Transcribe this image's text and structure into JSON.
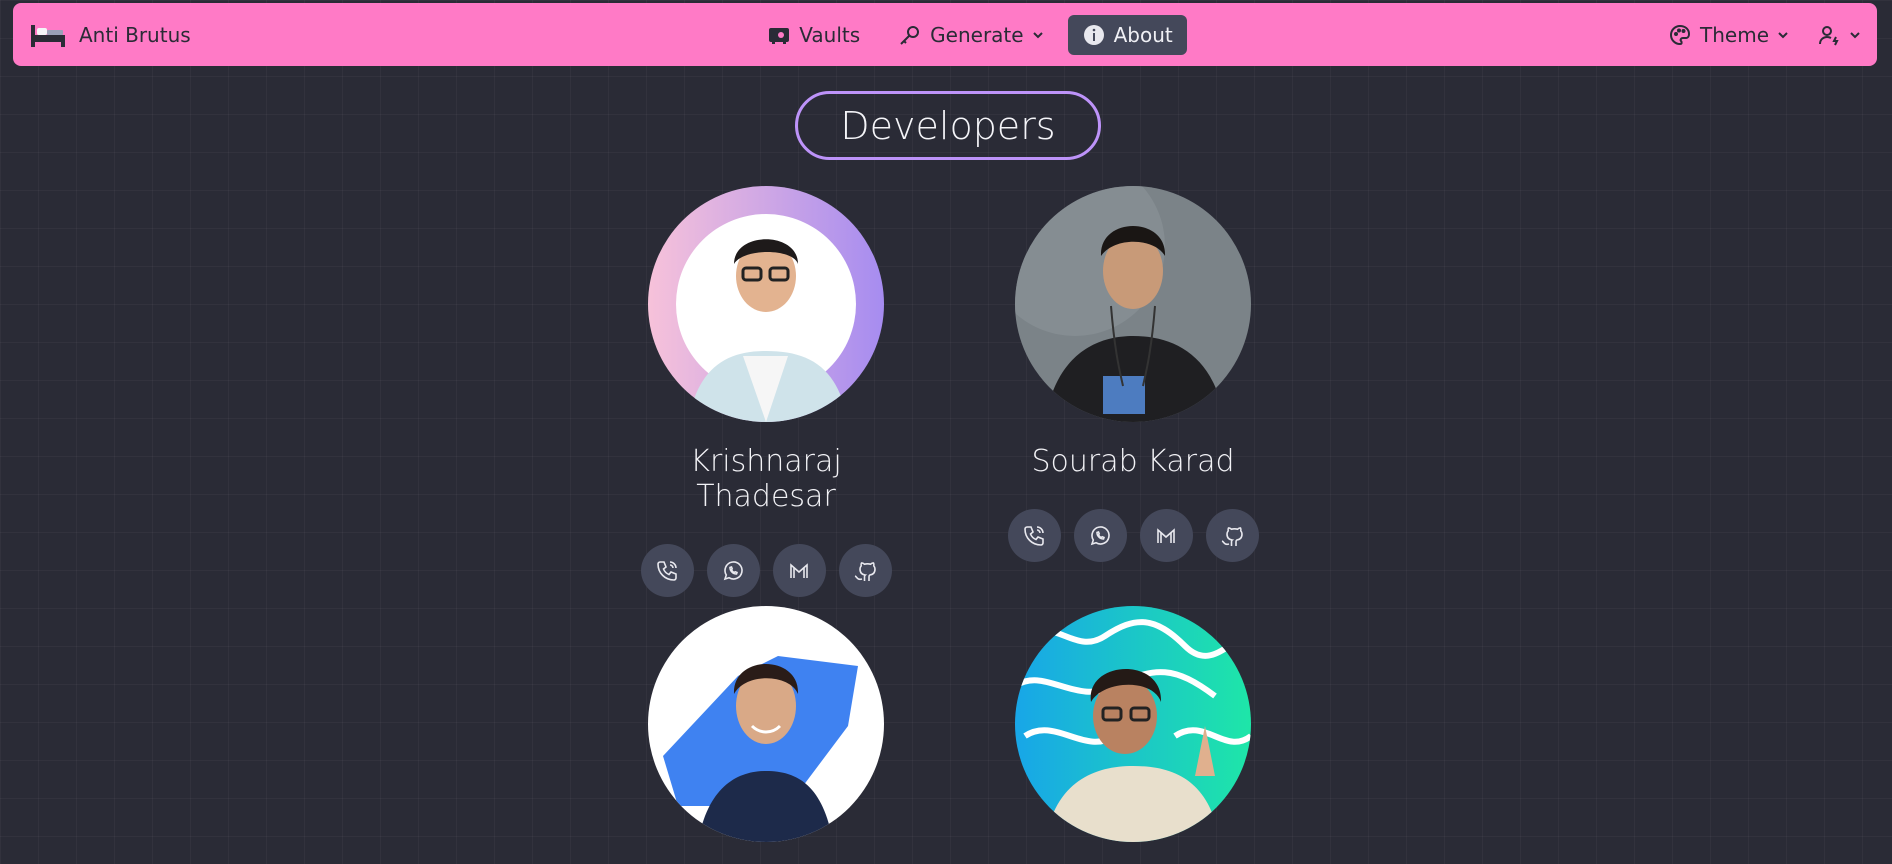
{
  "navbar": {
    "brand": "Anti Brutus",
    "items": [
      {
        "label": "Vaults",
        "icon": "vault-icon"
      },
      {
        "label": "Generate",
        "icon": "key-icon"
      },
      {
        "label": "About",
        "icon": "info-icon",
        "active": true
      }
    ],
    "theme_label": "Theme",
    "accent": "#ff7ac6"
  },
  "page": {
    "title": "Developers"
  },
  "developers": [
    {
      "name": "Krishnaraj Thadesar"
    },
    {
      "name": "Sourab Karad"
    },
    {
      "name": ""
    },
    {
      "name": ""
    }
  ],
  "social_icons": [
    "phone-icon",
    "whatsapp-icon",
    "gmail-icon",
    "github-icon"
  ]
}
